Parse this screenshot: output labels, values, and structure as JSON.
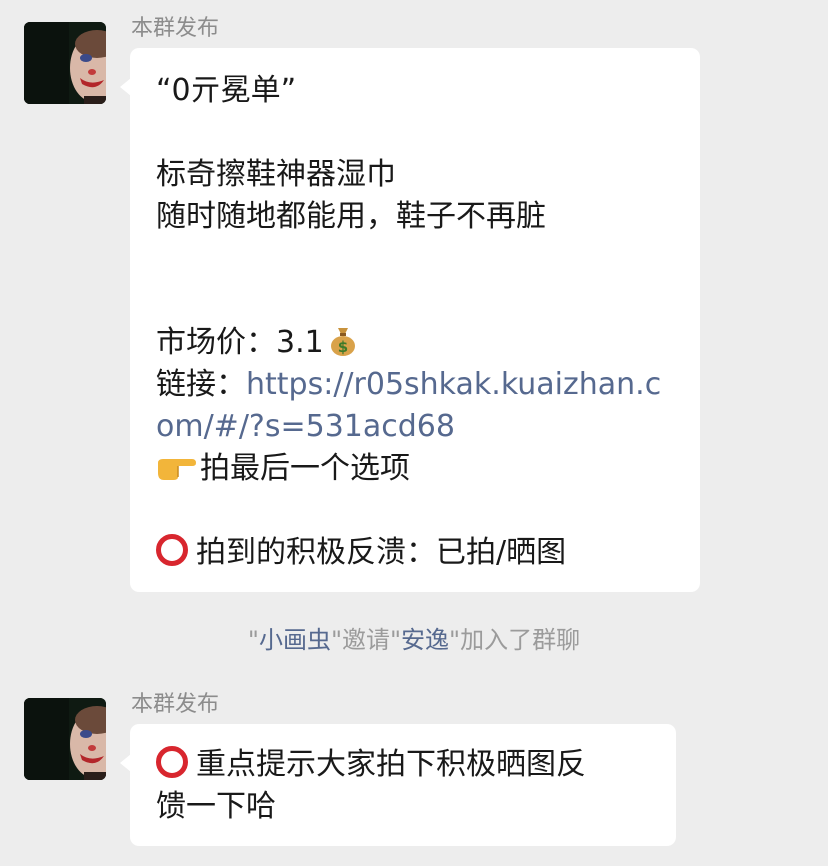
{
  "messages": [
    {
      "sender": "本群发布",
      "avatar_icon": "clown-avatar-icon",
      "lines": {
        "title": "“0亓冕单”",
        "product": "标奇擦鞋神器湿巾",
        "slogan": "随时随地都能用，鞋子不再脏",
        "price_label": "市场价：",
        "price_value": "3.1",
        "price_icon": "money-bag-icon",
        "link_label": "链接：",
        "link_part1": "https://r05shkak.kuaizhan.c",
        "link_part2": "om/#/?s=531acd68",
        "instruction_icon": "pointing-hand-icon",
        "instruction": "拍最后一个选项",
        "feedback_icon": "red-circle-icon",
        "feedback": "拍到的积极反溃：已拍/晒图"
      }
    },
    {
      "sender": "本群发布",
      "avatar_icon": "clown-avatar-icon",
      "lines": {
        "reminder_icon": "red-circle-icon",
        "reminder_line1": "重点提示大家拍下积极晒图反",
        "reminder_line2": "馈一下哈"
      }
    }
  ],
  "system_notice": {
    "quote_open_1": "\"",
    "inviter": "小画虫",
    "quote_close_1": "\"",
    "action": "邀请",
    "quote_open_2": "\"",
    "invitee": "安逸",
    "quote_close_2": "\"",
    "suffix": "加入了群聊"
  },
  "colors": {
    "background": "#ededed",
    "bubble": "#ffffff",
    "link": "#56698f",
    "sender": "#8c8c8c",
    "system_text": "#9b9b9b",
    "red_circle": "#d8262e"
  }
}
